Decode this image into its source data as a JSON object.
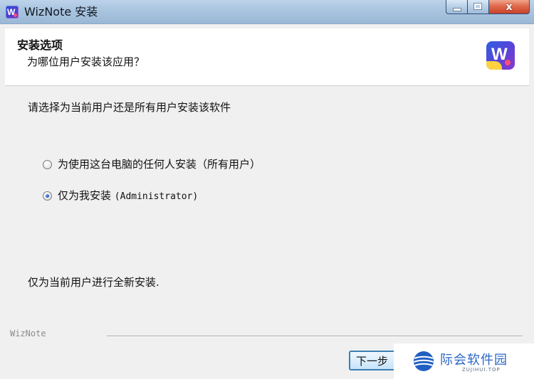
{
  "window": {
    "title": "WizNote 安装",
    "close_glyph": "x"
  },
  "header": {
    "title": "安装选项",
    "subtitle": "为哪位用户安装该应用？",
    "logo_letter": "W"
  },
  "body": {
    "instruction": "请选择为当前用户还是所有用户安装该软件",
    "options": [
      {
        "label": "为使用这台电脑的任何人安装（所有用户）",
        "selected": false
      },
      {
        "label": "仅为我安装",
        "label_suffix": "(Administrator)",
        "selected": true
      }
    ],
    "description": "仅为当前用户进行全新安装."
  },
  "footer": {
    "brand": "WizNote",
    "next_label": "下一步"
  },
  "watermark": {
    "text": "际会软件园",
    "subtext": "ZUJIHUI.TOP"
  },
  "colors": {
    "title_gradient_top": "#bcd3ea",
    "close_button": "#e06a4c",
    "accent_blue": "#2b67c7",
    "logo_purple": "#5a43d8"
  },
  "icons": {
    "app": "wiznote-app-icon",
    "header_logo": "wiznote-logo-icon",
    "watermark_logo": "globe-icon"
  }
}
